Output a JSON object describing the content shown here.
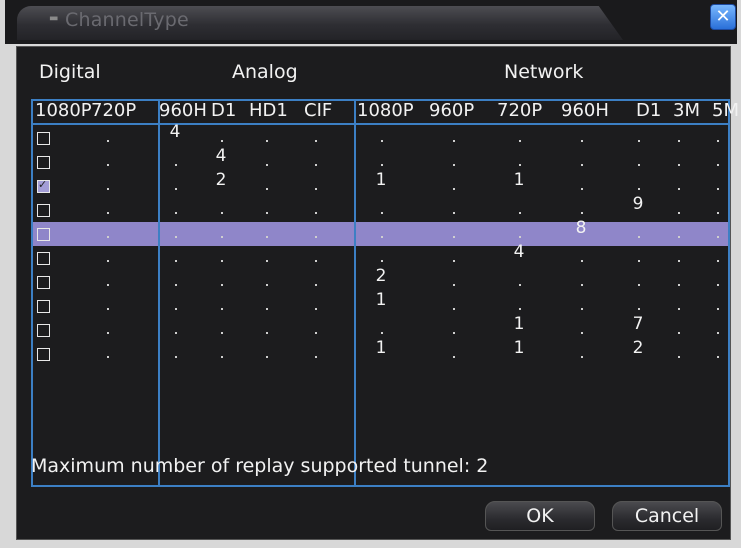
{
  "window": {
    "title": "ChannelType",
    "title_icon": "monitor-icon",
    "close_symbol": "✕"
  },
  "groups": {
    "digital": "Digital",
    "analog": "Analog",
    "network": "Network"
  },
  "columns": {
    "digital": [
      "1080P",
      "720P"
    ],
    "analog": [
      "960H",
      "D1",
      "HD1",
      "CIF"
    ],
    "network": [
      "1080P",
      "960P",
      "720P",
      "960H",
      "D1",
      "3M",
      "5M"
    ]
  },
  "rows": [
    {
      "checked": false,
      "values": [
        "",
        "",
        "4",
        "",
        "",
        "",
        "",
        "",
        "",
        "",
        "",
        "",
        ""
      ]
    },
    {
      "checked": false,
      "values": [
        "",
        "",
        "",
        "4",
        "",
        "",
        "",
        "",
        "",
        "",
        "",
        "",
        ""
      ]
    },
    {
      "checked": true,
      "values": [
        "",
        "",
        "",
        "2",
        "",
        "",
        "1",
        "",
        "1",
        "",
        "",
        "",
        ""
      ]
    },
    {
      "checked": false,
      "values": [
        "",
        "",
        "",
        "",
        "",
        "",
        "",
        "",
        "",
        "",
        "9",
        "",
        ""
      ]
    },
    {
      "checked": false,
      "values": [
        "",
        "",
        "",
        "",
        "",
        "",
        "",
        "",
        "",
        "8",
        "",
        "",
        ""
      ]
    },
    {
      "checked": false,
      "values": [
        "",
        "",
        "",
        "",
        "",
        "",
        "",
        "",
        "4",
        "",
        "",
        "",
        ""
      ]
    },
    {
      "checked": false,
      "values": [
        "",
        "",
        "",
        "",
        "",
        "",
        "2",
        "",
        "",
        "",
        "",
        "",
        ""
      ]
    },
    {
      "checked": false,
      "values": [
        "",
        "",
        "",
        "",
        "",
        "",
        "1",
        "",
        "",
        "",
        "",
        "",
        ""
      ]
    },
    {
      "checked": false,
      "values": [
        "",
        "",
        "",
        "",
        "",
        "",
        "",
        "",
        "1",
        "",
        "7",
        "",
        ""
      ]
    },
    {
      "checked": false,
      "values": [
        "",
        "",
        "",
        "",
        "",
        "",
        "1",
        "",
        "1",
        "",
        "2",
        "",
        ""
      ]
    }
  ],
  "info_text": "Maximum number of replay supported tunnel: 2",
  "buttons": {
    "ok": "OK",
    "cancel": "Cancel"
  },
  "colors": {
    "accent_border": "#3c7fc4",
    "selected_row": "#8f86c9",
    "background": "#1c1c1e"
  }
}
